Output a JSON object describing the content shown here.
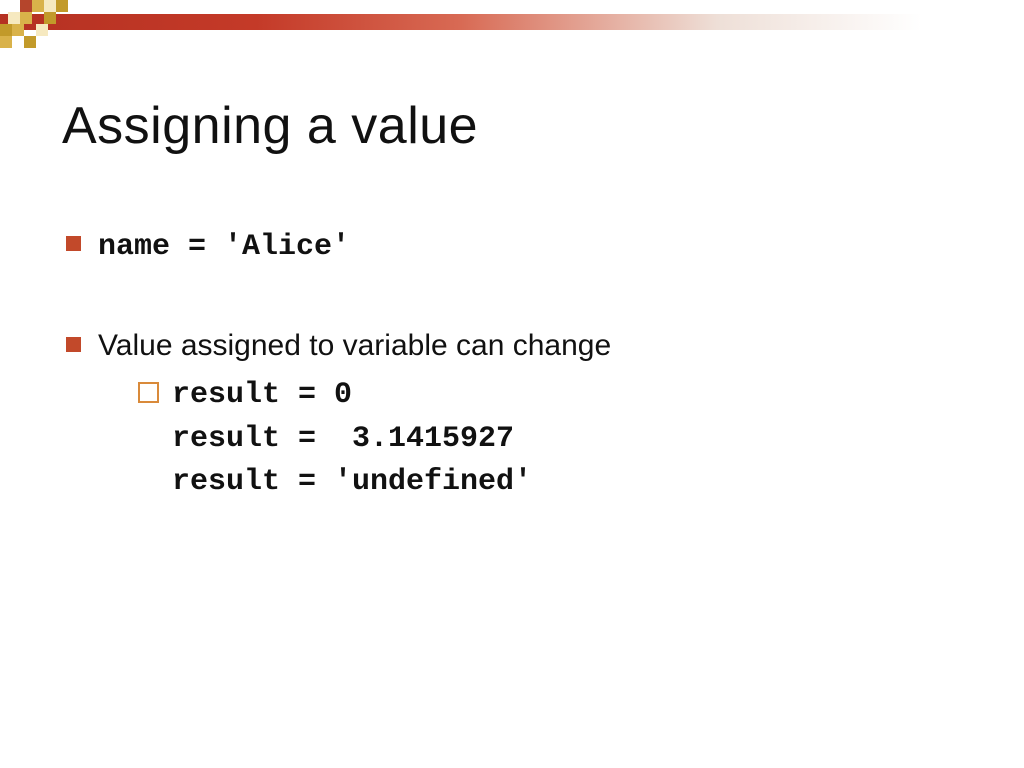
{
  "title": "Assigning a value",
  "bullets": [
    {
      "text": "name = 'Alice'",
      "mono": true
    },
    {
      "text": "Value assigned to  variable can change",
      "mono": false,
      "sub": {
        "code": "result = 0\nresult =  3.1415927\nresult = 'undefined'"
      }
    }
  ]
}
